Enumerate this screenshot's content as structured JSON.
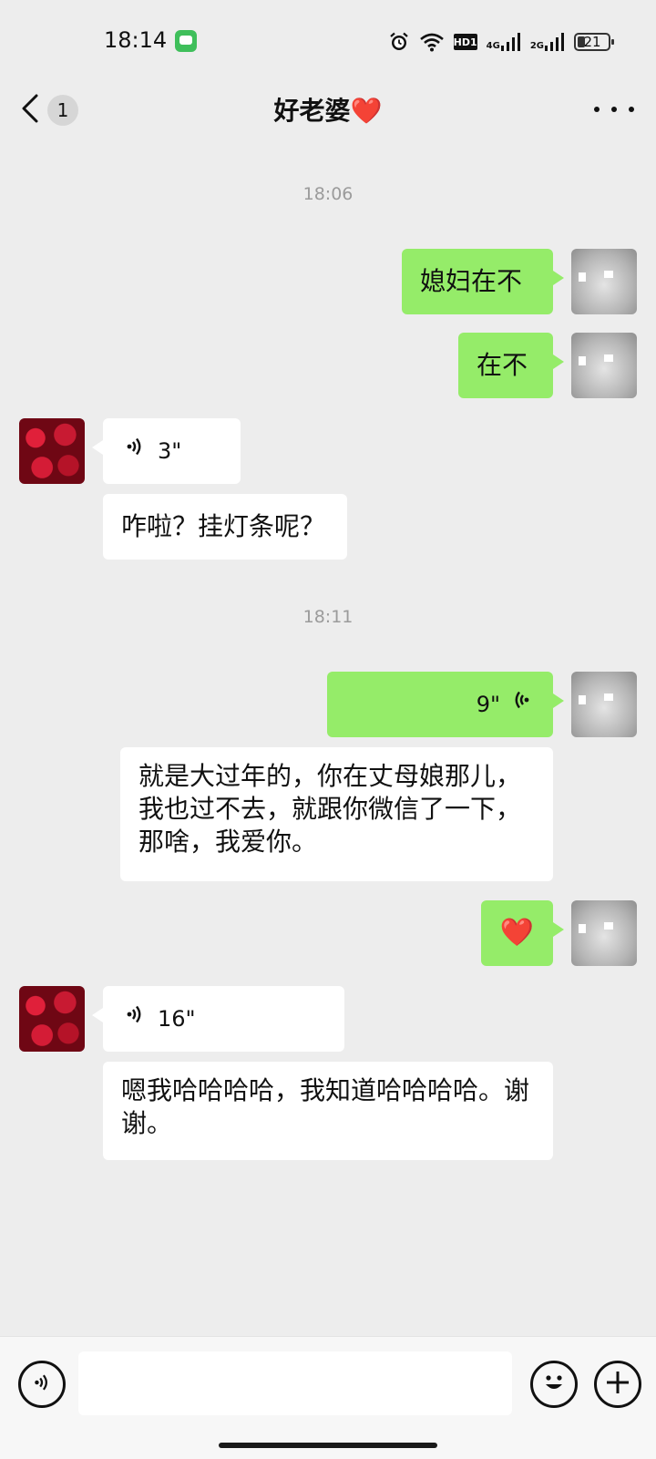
{
  "status_bar": {
    "time": "18:14",
    "hd_label": "HD1",
    "network_1": "4G",
    "network_2": "2G",
    "battery": "21"
  },
  "nav": {
    "unread_count": "1",
    "title": "好老婆",
    "title_emoji": "❤️"
  },
  "messages": {
    "time_1": "18:06",
    "m1": "媳妇在不",
    "m2": "在不",
    "m3_voice": "3\"",
    "m4": "咋啦？挂灯条呢？",
    "time_2": "18:11",
    "m5_voice": "9\"",
    "m5_transcript": "就是大过年的，你在丈母娘那儿，我也过不去，就跟你微信了一下，那啥，我爱你。",
    "m6_emoji": "❤️",
    "m7_voice": "16\"",
    "m8_transcript": "嗯我哈哈哈哈，我知道哈哈哈哈。谢谢。"
  },
  "input": {
    "placeholder": ""
  }
}
